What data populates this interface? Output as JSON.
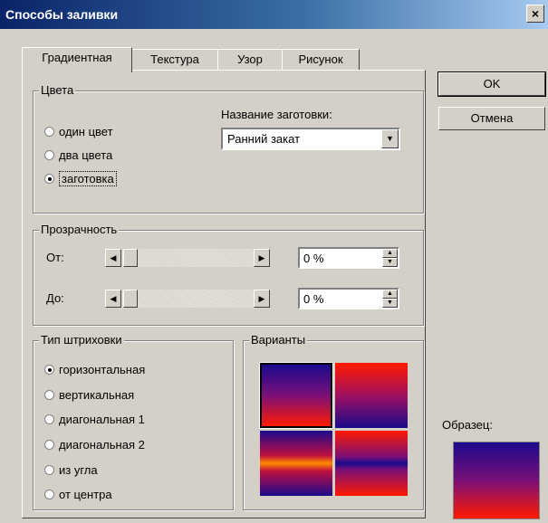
{
  "window": {
    "title": "Способы заливки",
    "close_glyph": "×"
  },
  "tabs": [
    {
      "label": "Градиентная",
      "active": true
    },
    {
      "label": "Текстура"
    },
    {
      "label": "Узор"
    },
    {
      "label": "Рисунок"
    }
  ],
  "colors": {
    "legend": "Цвета",
    "options": [
      {
        "label": "один цвет",
        "selected": false
      },
      {
        "label": "два цвета",
        "selected": false
      },
      {
        "label": "заготовка",
        "selected": true
      }
    ],
    "preset_label": "Название заготовки:",
    "preset_value": "Ранний закат"
  },
  "transparency": {
    "legend": "Прозрачность",
    "from_label": "От:",
    "to_label": "До:",
    "from_value": "0 %",
    "to_value": "0 %"
  },
  "shading": {
    "legend": "Тип штриховки",
    "options": [
      {
        "label": "горизонтальная",
        "selected": true
      },
      {
        "label": "вертикальная"
      },
      {
        "label": "диагональная 1"
      },
      {
        "label": "диагональная 2"
      },
      {
        "label": "из угла"
      },
      {
        "label": "от центра"
      }
    ]
  },
  "variants": {
    "legend": "Варианты"
  },
  "buttons": {
    "ok": "OK",
    "cancel": "Отмена"
  },
  "sample": {
    "label": "Образец:"
  },
  "palette": {
    "navy": "#1a0a8c",
    "red": "#ff1a00",
    "orange": "#ff8a00"
  }
}
